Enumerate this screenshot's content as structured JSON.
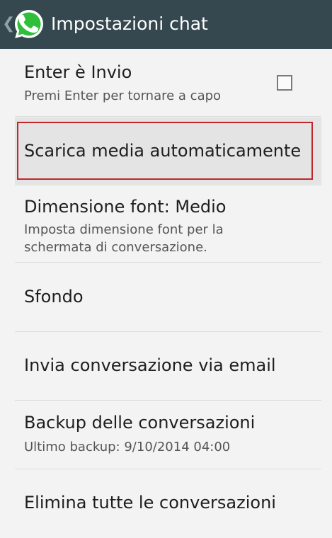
{
  "action_bar": {
    "title": "Impostazioni chat",
    "up_icon": "chevron-left-icon",
    "logo_icon": "whatsapp-logo-icon",
    "background_color": "#35484f",
    "logo_color": "#2fbf3a"
  },
  "settings": {
    "enter_is_send": {
      "title": "Enter è Invio",
      "summary": "Premi Enter per tornare a capo",
      "checked": false
    },
    "auto_download": {
      "title": "Scarica media automaticamente"
    },
    "font_size": {
      "title": "Dimensione font: Medio",
      "summary": "Imposta dimensione font per la schermata di conversazione."
    },
    "wallpaper": {
      "title": "Sfondo"
    },
    "email_chat": {
      "title": "Invia conversazione via email"
    },
    "backup": {
      "title": "Backup delle conversazioni",
      "summary": "Ultimo backup: 9/10/2014 04:00"
    },
    "delete_all": {
      "title": "Elimina tutte le conversazioni"
    }
  },
  "colors": {
    "highlight_border": "#c0272d"
  }
}
